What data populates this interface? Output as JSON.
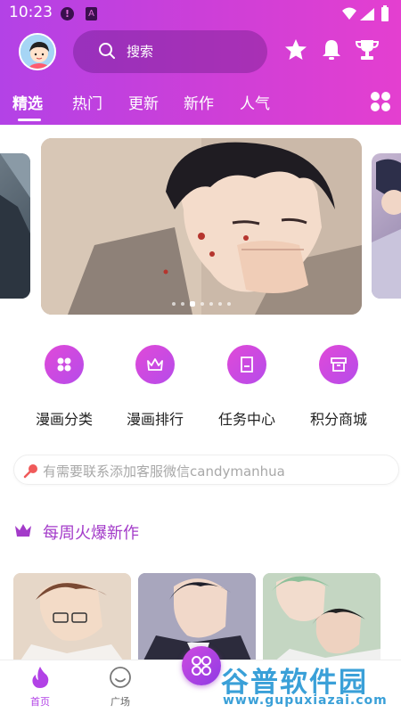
{
  "status_bar": {
    "time": "10:23",
    "alert_badge": "!",
    "app_badge": "A"
  },
  "header": {
    "search_placeholder": "搜索",
    "tabs": [
      {
        "label": "精选",
        "active": true
      },
      {
        "label": "热门",
        "active": false
      },
      {
        "label": "更新",
        "active": false
      },
      {
        "label": "新作",
        "active": false
      },
      {
        "label": "人气",
        "active": false
      }
    ]
  },
  "banner": {
    "total_slides": 7,
    "active_slide": 3
  },
  "menu": [
    {
      "label": "漫画分类",
      "icon": "grid-icon"
    },
    {
      "label": "漫画排行",
      "icon": "crown-icon"
    },
    {
      "label": "任务中心",
      "icon": "task-icon"
    },
    {
      "label": "积分商城",
      "icon": "store-icon"
    }
  ],
  "notice": {
    "text": "有需要联系添加客服微信candymanhua"
  },
  "section": {
    "title": "每周火爆新作"
  },
  "bottom_nav": [
    {
      "label": "首页",
      "active": true
    },
    {
      "label": "广场",
      "active": false
    }
  ],
  "watermark": {
    "main": "谷普软件园",
    "sub": "www.gupuxiazai.com"
  },
  "colors": {
    "accent": "#b242e6",
    "accent_pink": "#e43fd0",
    "section_title": "#a33bc9"
  }
}
